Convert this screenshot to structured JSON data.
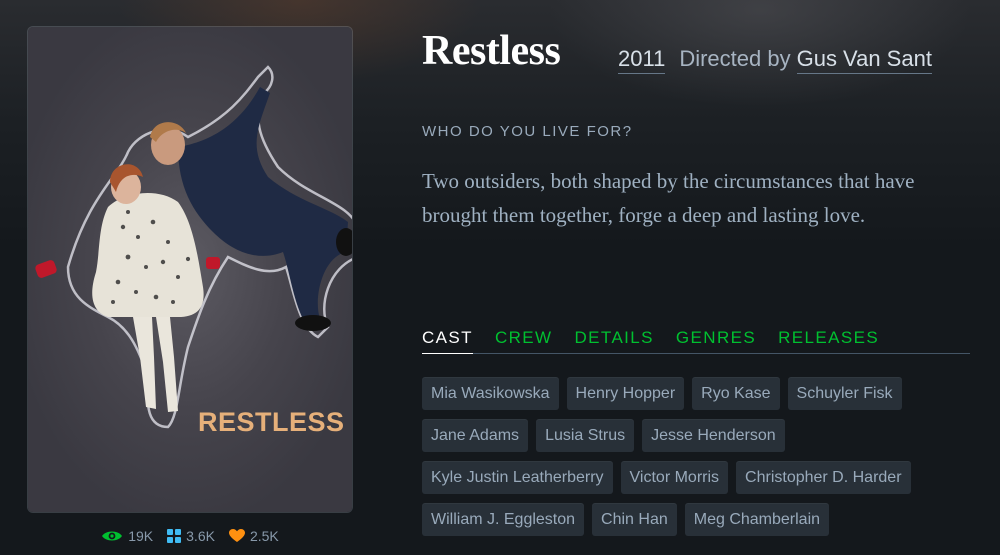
{
  "film": {
    "title": "Restless",
    "year": "2011",
    "directed_by_label": "Directed by",
    "director": "Gus Van Sant",
    "tagline": "WHO DO YOU LIVE FOR?",
    "synopsis": "Two outsiders, both shaped by the circumstances that have brought them together, forge a deep and lasting love."
  },
  "poster": {
    "title_text": "RESTLESS",
    "accent_color": "#e6b07a"
  },
  "stats": {
    "views": "19K",
    "views_icon": "eye-icon",
    "lists": "3.6K",
    "lists_icon": "grid-icon",
    "likes": "2.5K",
    "likes_icon": "heart-icon"
  },
  "tabs": [
    {
      "label": "CAST",
      "active": true
    },
    {
      "label": "CREW",
      "active": false
    },
    {
      "label": "DETAILS",
      "active": false
    },
    {
      "label": "GENRES",
      "active": false
    },
    {
      "label": "RELEASES",
      "active": false
    }
  ],
  "cast": [
    "Mia Wasikowska",
    "Henry Hopper",
    "Ryo Kase",
    "Schuyler Fisk",
    "Jane Adams",
    "Lusia Strus",
    "Jesse Henderson",
    "Kyle Justin Leatherberry",
    "Victor Morris",
    "Christopher D. Harder",
    "William J. Eggleston",
    "Chin Han",
    "Meg Chamberlain"
  ],
  "colors": {
    "background": "#14181c",
    "tab_accent": "#00c030",
    "views_icon": "#00c030",
    "lists_icon": "#40bcf4",
    "likes_icon": "#ff9010"
  }
}
